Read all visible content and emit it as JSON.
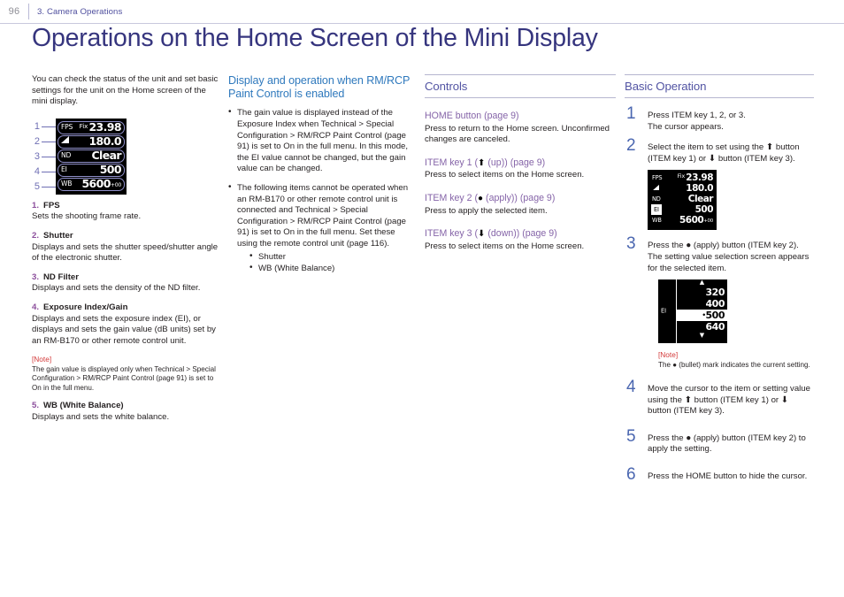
{
  "header": {
    "folio": "96",
    "chapter": "3. Camera Operations"
  },
  "title": "Operations on the Home Screen of the Mini Display",
  "column1": {
    "intro": "You can check the status of the unit and set basic settings for the unit on the Home screen of the mini display.",
    "figure": {
      "callouts": [
        "1",
        "2",
        "3",
        "4",
        "5"
      ],
      "rows": [
        {
          "label": "FPS",
          "prefix": "Fix",
          "value": "23.98",
          "sup": ""
        },
        {
          "label": "angle-icon",
          "prefix": "",
          "value": "180.0",
          "sup": ""
        },
        {
          "label": "ND",
          "prefix": "",
          "value": "Clear",
          "sup": ""
        },
        {
          "label": "EI",
          "prefix": "",
          "value": "500",
          "sup": ""
        },
        {
          "label": "WB",
          "prefix": "",
          "value": "5600",
          "sup": "+00"
        }
      ]
    },
    "items": [
      {
        "num": "1.",
        "title": "FPS",
        "body": "Sets the shooting frame rate."
      },
      {
        "num": "2.",
        "title": "Shutter",
        "body": "Displays and sets the shutter speed/shutter angle of the electronic shutter."
      },
      {
        "num": "3.",
        "title": "ND Filter",
        "body": "Displays and sets the density of the ND filter."
      },
      {
        "num": "4.",
        "title": "Exposure Index/Gain",
        "body": "Displays and sets the exposure index (EI), or displays and sets the gain value (dB units) set by an RM-B170 or other remote control unit."
      },
      {
        "num": "5.",
        "title": "WB (White Balance)",
        "body": "Displays and sets the white balance."
      }
    ],
    "note": {
      "label": "[Note]",
      "body": "The gain value is displayed only when Technical > Special Configuration > RM/RCP Paint Control (page 91) is set to On in the full menu."
    }
  },
  "column2": {
    "heading": "Display and operation when RM/RCP Paint Control is enabled",
    "bullets": [
      "The gain value is displayed instead of the Exposure Index when Technical > Special Configuration > RM/RCP Paint Control (page 91) is set to On in the full menu. In this mode, the EI value cannot be changed, but the gain value can be changed.",
      "The following items cannot be operated when an RM-B170 or other remote control unit is connected and Technical > Special Configuration > RM/RCP Paint Control (page 91) is set to On in the full menu. Set these using the remote control unit (page 116)."
    ],
    "sub_bullets": [
      "Shutter",
      "WB (White Balance)"
    ]
  },
  "column3": {
    "heading": "Controls",
    "entries": [
      {
        "title_pre": "HOME button (page 9)",
        "title_icon": "",
        "title_post": "",
        "desc": "Press to return to the Home screen. Unconfirmed changes are canceled."
      },
      {
        "title_pre": "ITEM key 1 (",
        "title_icon": "up-arrow-icon",
        "title_post": " (up)) (page 9)",
        "desc": "Press to select items on the Home screen."
      },
      {
        "title_pre": "ITEM key 2 (",
        "title_icon": "bullet-circle-icon",
        "title_post": " (apply)) (page 9)",
        "desc": "Press to apply the selected item."
      },
      {
        "title_pre": "ITEM key 3 (",
        "title_icon": "down-arrow-icon",
        "title_post": " (down)) (page 9)",
        "desc": "Press to select items on the Home screen."
      }
    ]
  },
  "column4": {
    "heading": "Basic Operation",
    "steps": [
      {
        "num": "1",
        "text": "Press ITEM key 1, 2, or 3.\nThe cursor appears."
      },
      {
        "num": "2",
        "text_a": "Select the item to set using the ",
        "icon_a": "up-arrow-icon",
        "text_b": " button (ITEM key 1) or ",
        "icon_b": "down-arrow-icon",
        "text_c": " button (ITEM key 3)."
      },
      {
        "num": "3",
        "text_a": "Press the ",
        "icon_a": "bullet-circle-icon",
        "text_b": " (apply) button (ITEM key 2). The setting value selection screen appears for the selected item."
      },
      {
        "num": "4",
        "text_a": "Move the cursor to the item or setting value using the ",
        "icon_a": "up-arrow-icon",
        "text_b": " button (ITEM key 1) or ",
        "icon_b": "down-arrow-icon",
        "text_c": " button (ITEM key 3)."
      },
      {
        "num": "5",
        "text_a": "Press the ",
        "icon_a": "bullet-circle-icon",
        "text_b": " (apply) button (ITEM key 2) to apply the setting."
      },
      {
        "num": "6",
        "text_a": "Press the HOME button to hide the cursor.",
        "icon_a": "",
        "text_b": ""
      }
    ],
    "figure2": {
      "rows": [
        {
          "label": "FPS",
          "prefix": "Fix",
          "value": "23.98",
          "sup": "",
          "selected": false
        },
        {
          "label": "angle-icon",
          "prefix": "",
          "value": "180.0",
          "sup": "",
          "selected": false
        },
        {
          "label": "ND",
          "prefix": "",
          "value": "Clear",
          "sup": "",
          "selected": false
        },
        {
          "label": "EI",
          "prefix": "",
          "value": "500",
          "sup": "",
          "selected": true
        },
        {
          "label": "WB",
          "prefix": "",
          "value": "5600",
          "sup": "+00",
          "selected": false
        }
      ]
    },
    "figure3": {
      "side_label": "EI",
      "up_arrow": "▲",
      "down_arrow": "▼",
      "values": [
        {
          "text": "320",
          "current": false
        },
        {
          "text": "400",
          "current": false
        },
        {
          "text": "500",
          "current": true
        },
        {
          "text": "640",
          "current": false
        }
      ]
    },
    "note": {
      "label": "[Note]",
      "text_a": "The ",
      "icon": "bullet-circle-icon",
      "text_b": " (bullet) mark indicates the current setting."
    }
  },
  "icons": {
    "up-arrow-icon": "⬆",
    "down-arrow-icon": "⬇",
    "bullet-circle-icon": "●"
  },
  "colors": {
    "title": "#36357e",
    "section_head": "#4a66b0",
    "sub_head_blue": "#2f79bd",
    "control_title": "#8564a8",
    "list_num": "#8c4f9c",
    "note_red": "#d33a3a",
    "callout": "#6f6fb4",
    "chapter": "#4f4f9e"
  }
}
